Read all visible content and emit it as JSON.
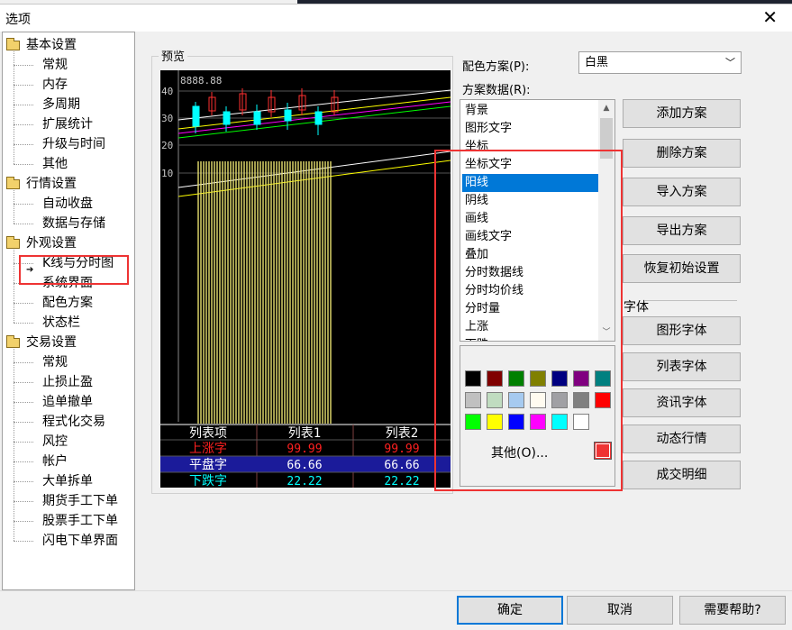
{
  "window": {
    "title": "选项"
  },
  "tree": {
    "groups": [
      {
        "label": "基本设置",
        "items": [
          "常规",
          "内存",
          "多周期",
          "扩展统计",
          "升级与时间",
          "其他"
        ]
      },
      {
        "label": "行情设置",
        "items": [
          "自动收盘",
          "数据与存储"
        ]
      },
      {
        "label": "外观设置",
        "items": [
          "K线与分时图",
          "系统界面",
          "配色方案",
          "状态栏"
        ]
      },
      {
        "label": "交易设置",
        "items": [
          "常规",
          "止损止盈",
          "追单撤单",
          "程式化交易",
          "风控",
          "帐户",
          "大单拆单",
          "期货手工下单",
          "股票手工下单",
          "闪电下单界面"
        ]
      }
    ],
    "selected": "配色方案"
  },
  "preview": {
    "label": "预览",
    "price_label": "8888.88",
    "axis_ticks": [
      "40",
      "30",
      "20",
      "10"
    ],
    "table": {
      "headers": [
        "列表项",
        "列表1",
        "列表2"
      ],
      "rows": [
        {
          "name": "上涨字",
          "v1": "99.99",
          "v2": "99.99",
          "color": "#ff2020"
        },
        {
          "name": "平盘字",
          "v1": "66.66",
          "v2": "66.66",
          "color": "#ffffff"
        },
        {
          "name": "下跌字",
          "v1": "22.22",
          "v2": "22.22",
          "color": "#00ffff"
        }
      ]
    }
  },
  "scheme": {
    "label": "配色方案(P):",
    "value": "白黑",
    "data_label": "方案数据(R):",
    "items": [
      "背景",
      "图形文字",
      "坐标",
      "坐标文字",
      "阳线",
      "阴线",
      "画线",
      "画线文字",
      "叠加",
      "分时数据线",
      "分时均价线",
      "分时量",
      "上涨",
      "下跌"
    ],
    "selected": "阳线"
  },
  "palette": {
    "colors": [
      "#000000",
      "#800000",
      "#008000",
      "#808000",
      "#000080",
      "#800080",
      "#008080",
      "#c0c0c0",
      "#c0dcc0",
      "#a6caf0",
      "#fffbf0",
      "#a0a0a4",
      "#808080",
      "#ff0000",
      "#00ff00",
      "#ffff00",
      "#0000ff",
      "#ff00ff",
      "#00ffff",
      "#ffffff"
    ],
    "other_label": "其他(O)...",
    "current": "#ef3333"
  },
  "buttons": {
    "add": "添加方案",
    "delete": "删除方案",
    "import": "导入方案",
    "export": "导出方案",
    "restore": "恢复初始设置",
    "font_section": "字体",
    "graph_font": "图形字体",
    "list_font": "列表字体",
    "info_font": "资讯字体",
    "dynamic": "动态行情",
    "trades": "成交明细"
  },
  "footer": {
    "ok": "确定",
    "cancel": "取消",
    "help": "需要帮助?"
  }
}
